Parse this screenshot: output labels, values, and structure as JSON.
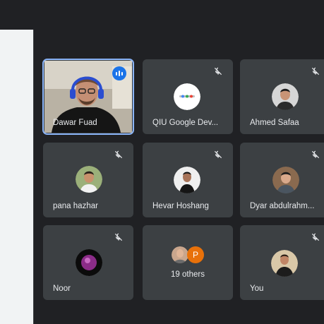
{
  "participants": [
    {
      "name": "Dawar Fuad",
      "speaking": true
    },
    {
      "name": "QIU Google Dev...",
      "muted": true
    },
    {
      "name": "Ahmed Safaa",
      "muted": true
    },
    {
      "name": "pana hazhar",
      "muted": true
    },
    {
      "name": "Hevar Hoshang",
      "muted": true
    },
    {
      "name": "Dyar abdulrahm...",
      "muted": true
    },
    {
      "name": "Noor",
      "muted": true
    },
    {
      "name": "You",
      "muted": true
    }
  ],
  "others": {
    "label": "19 others",
    "initial": "P"
  },
  "icons": {
    "mute": "mic-off-icon",
    "speaking": "audio-wave-icon"
  },
  "colors": {
    "tile": "#3c4043",
    "background": "#202124",
    "accent": "#8ab4f8",
    "speak": "#1a73e8",
    "others_avatar": "#e8710a"
  }
}
